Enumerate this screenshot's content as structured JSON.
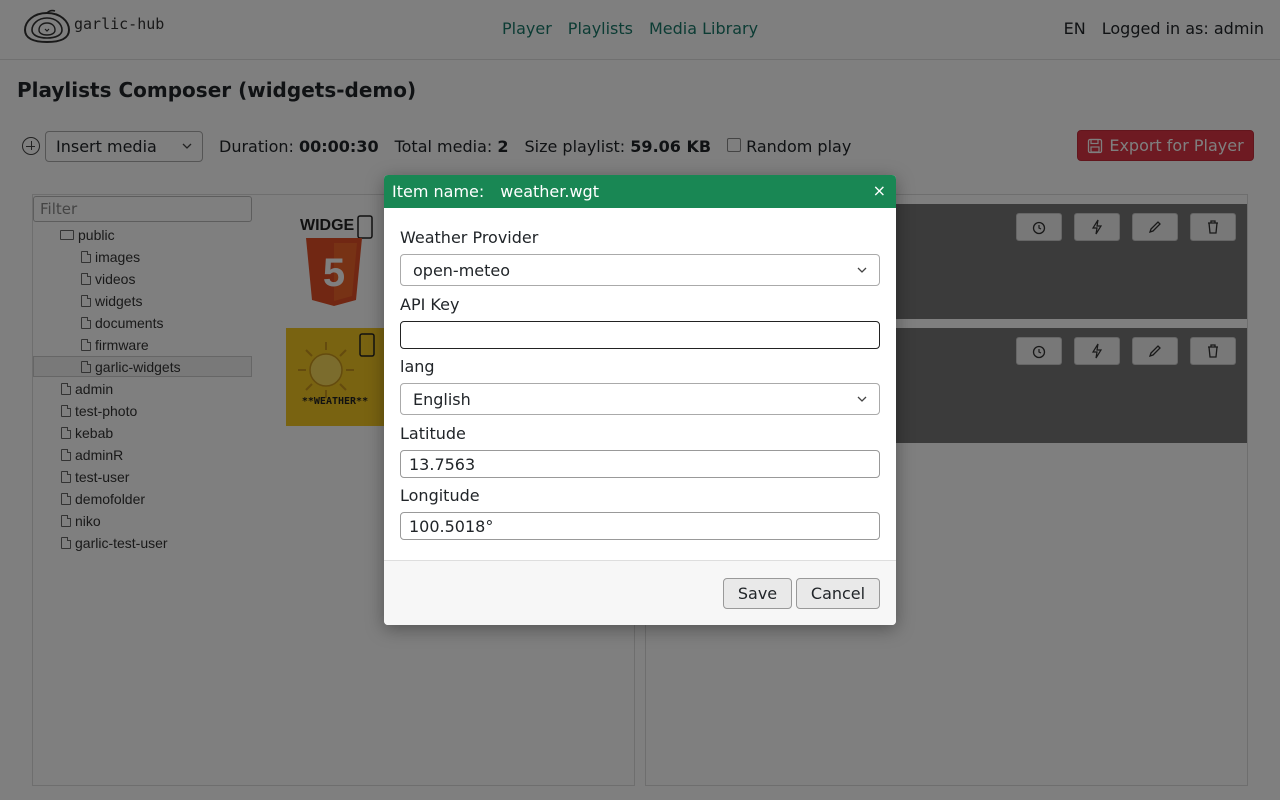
{
  "header": {
    "logo_text": "garlic-hub",
    "nav": [
      "Player",
      "Playlists",
      "Media Library"
    ],
    "lang": "EN",
    "login_text": "Logged in as: admin"
  },
  "page": {
    "title": "Playlists Composer (widgets-demo)"
  },
  "toolbar": {
    "insert_select": "Insert media",
    "duration_label": "Duration:",
    "duration_value": "00:00:30",
    "total_label": "Total media:",
    "total_value": "2",
    "size_label": "Size playlist:",
    "size_value": "59.06 KB",
    "random_label": "Random play",
    "export_label": "Export for Player"
  },
  "media_browser": {
    "filter_placeholder": "Filter",
    "tree": {
      "root": "public",
      "children": [
        "images",
        "videos",
        "widgets",
        "documents",
        "firmware",
        "garlic-widgets"
      ],
      "others": [
        "admin",
        "test-photo",
        "kebab",
        "adminR",
        "test-user",
        "demofolder",
        "niko",
        "garlic-test-user"
      ]
    },
    "thumbs": {
      "html5_label": "WIDGE",
      "weather_label": "**WEATHER**"
    }
  },
  "modal": {
    "header_label": "Item name:",
    "header_value": "weather.wgt",
    "close": "×",
    "fields": {
      "provider_label": "Weather Provider",
      "provider_value": "open-meteo",
      "apikey_label": "API Key",
      "apikey_value": "",
      "lang_label": "lang",
      "lang_value": "English",
      "lat_label": "Latitude",
      "lat_value": "13.7563",
      "lon_label": "Longitude",
      "lon_value": "100.5018°"
    },
    "save_label": "Save",
    "cancel_label": "Cancel"
  },
  "colors": {
    "accent": "#198754",
    "danger": "#dc3545",
    "nav_link": "#197869"
  }
}
